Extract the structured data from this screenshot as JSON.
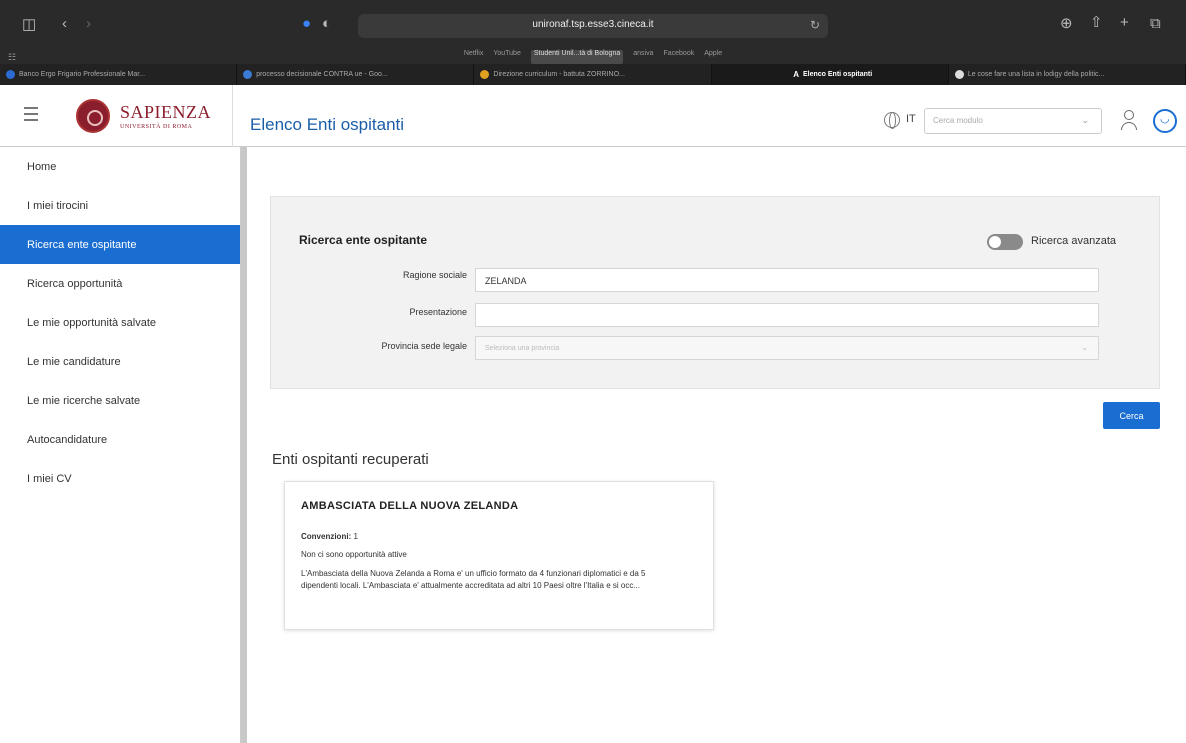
{
  "browser": {
    "url": "unironaf.tsp.esse3.cineca.it",
    "bookmarks": [
      "Netflix",
      "YouTube",
      "Studenti Unil...tà di Bologna",
      "ansiva",
      "Facebook",
      "Apple"
    ],
    "tabs": [
      {
        "label": "Banco Ergo Frigario Professionale Mar...",
        "color": "#2b6cd4"
      },
      {
        "label": "processo decisionale CONTRA ue - Goo...",
        "color": "#3a7bd5"
      },
      {
        "label": "Direzione curriculum - battuta ZORRINO...",
        "color": "#e0a020"
      },
      {
        "label": "Elenco Enti ospitanti",
        "color": "#ffffff"
      },
      {
        "label": "Le cose fare una lista in lodigy della politic...",
        "color": "#dddddd"
      }
    ]
  },
  "header": {
    "logo_name": "SAPIENZA",
    "logo_sub": "UNIVERSITÀ DI ROMA",
    "title": "Elenco Enti ospitanti",
    "lang": "IT",
    "module_placeholder": "Cerca modulo"
  },
  "sidebar": {
    "items": [
      {
        "label": "Home"
      },
      {
        "label": "I miei tirocini"
      },
      {
        "label": "Ricerca ente ospitante"
      },
      {
        "label": "Ricerca opportunità"
      },
      {
        "label": "Le mie opportunità salvate"
      },
      {
        "label": "Le mie candidature"
      },
      {
        "label": "Le mie ricerche salvate"
      },
      {
        "label": "Autocandidature"
      },
      {
        "label": "I miei CV"
      }
    ],
    "active_index": 2
  },
  "search": {
    "title": "Ricerca ente ospitante",
    "advanced_label": "Ricerca avanzata",
    "advanced_on": false,
    "fields": {
      "ragione_label": "Ragione sociale",
      "ragione_value": "ZELANDA",
      "presentazione_label": "Presentazione",
      "presentazione_value": "",
      "provincia_label": "Provincia sede legale",
      "provincia_placeholder": "Seleziona una provincia"
    },
    "submit_label": "Cerca"
  },
  "results": {
    "title": "Enti ospitanti recuperati",
    "items": [
      {
        "name": "AMBASCIATA DELLA NUOVA ZELANDA",
        "convenzioni_label": "Convenzioni:",
        "convenzioni_value": "1",
        "opportunities": "Non ci sono opportunità attive",
        "description": "L'Ambasciata della Nuova Zelanda a Roma e' un ufficio formato da 4 funzionari diplomatici e da 5 dipendenti locali. L'Ambasciata e' attualmente accreditata ad altri 10 Paesi oltre l'Italia e si occ..."
      }
    ]
  }
}
